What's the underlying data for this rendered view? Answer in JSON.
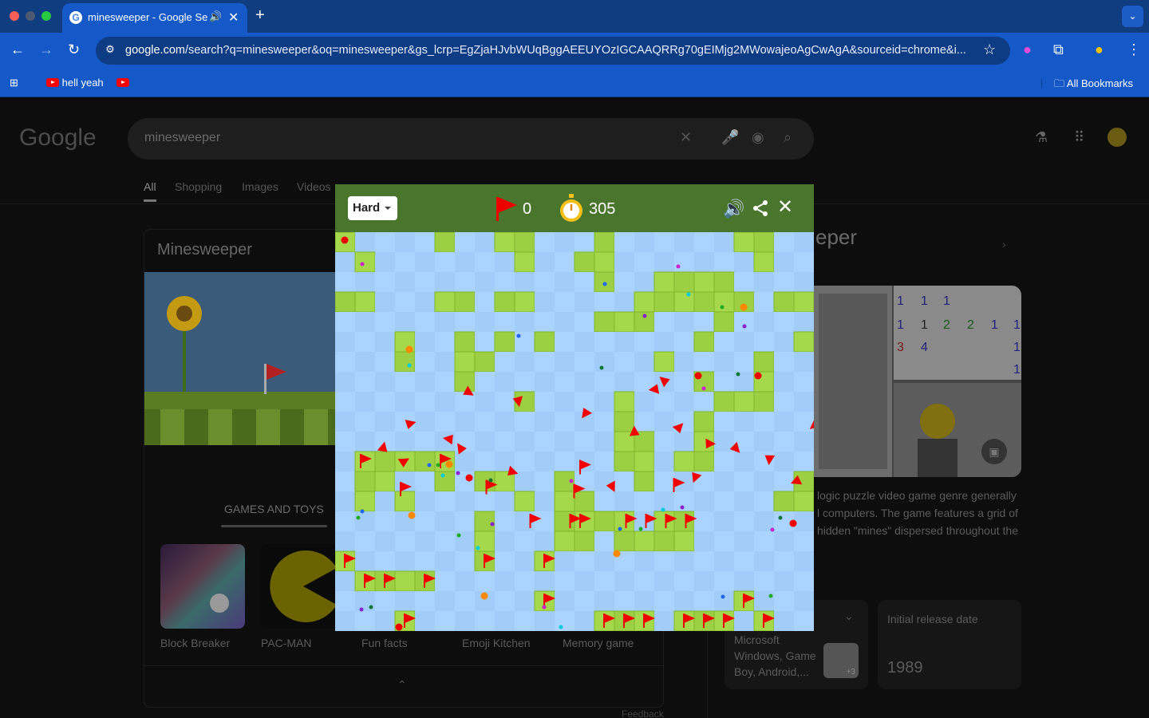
{
  "browser": {
    "tab": {
      "title": "minesweeper - Google Se",
      "close": "✕",
      "favicon": "G"
    },
    "new_tab": "+",
    "tab_search": "⌄",
    "url_prefix": "google.com",
    "url_rest": "/search?q=minesweeper&oq=minesweeper&gs_lcrp=EgZjaHJvbWUqBggAEEUYOzIGCAAQRRg70gEIMjg2MWowajeoAgCwAgA&sourceid=chrome&i...",
    "bookmarks": [
      {
        "label": "hell yeah"
      },
      {
        "label": ""
      }
    ],
    "all_bookmarks": "All Bookmarks"
  },
  "page": {
    "search_query": "minesweeper",
    "tabs": [
      "All",
      "Shopping",
      "Images",
      "Videos"
    ],
    "kp_title": "Minesweeper",
    "games_label": "GAMES AND TOYS",
    "games": [
      "Block Breaker",
      "PAC-MAN",
      "Fun facts",
      "Emoji Kitchen",
      "Memory game"
    ],
    "feedback": "Feedback",
    "kp_right_title": "eper",
    "kp_desc": "logic puzzle video game genre generally\nl computers. The game features a grid of\n hidden \"mines\" dispersed throughout the",
    "platforms_text": "Microsoft\nWindows, Game\nBoy, Android,...",
    "release_label": "Initial release date",
    "release_value": "1989",
    "img_more": "+3"
  },
  "game": {
    "difficulty": "Hard",
    "flags": "0",
    "time": "305",
    "colors": {
      "header": "#4a752c",
      "light_blue": "#aad4fe",
      "dark_blue": "#a2cdf9",
      "grass_light": "#a6d84c",
      "grass_dark": "#9ccf44",
      "flag": "#f20000"
    }
  }
}
